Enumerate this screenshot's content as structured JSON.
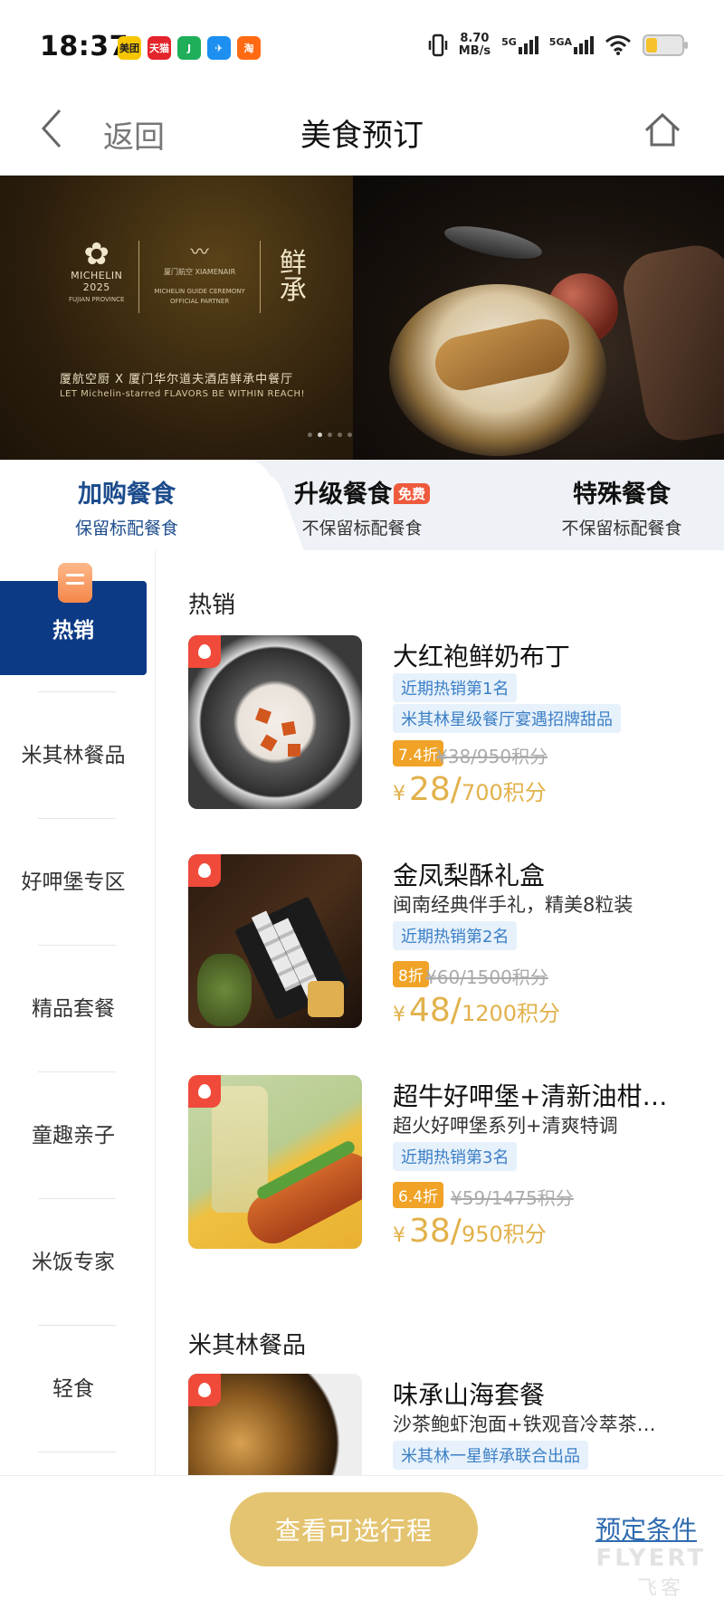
{
  "status_bar": {
    "time": "18:37",
    "apps": [
      {
        "label": "美团",
        "color": "#f7c600",
        "text_color": "#222"
      },
      {
        "label": "天猫",
        "color": "#e3252b",
        "text_color": "#fff"
      },
      {
        "label": "J",
        "color": "#1fae5a",
        "text_color": "#fff"
      },
      {
        "label": "✈",
        "color": "#1d8ff0",
        "text_color": "#fff"
      },
      {
        "label": "淘",
        "color": "#ff6a13",
        "text_color": "#fff"
      }
    ],
    "speed_top": "8.70",
    "speed_bottom": "MB/s",
    "net1": "5G",
    "net2": "5GA",
    "battery_pct": 0.25
  },
  "nav": {
    "back_label": "返回",
    "title": "美食预订"
  },
  "banner": {
    "michelin_name": "MICHELIN",
    "michelin_year": "2025",
    "michelin_region": "FUJIAN PROVINCE",
    "airline": "厦门航空 XIAMENAIR",
    "ceremony": "MICHELIN GUIDE CEREMONY",
    "partner": "OFFICIAL PARTNER",
    "restaurant_mark": "鲜承",
    "caption": "厦航空厨 X 厦门华尔道夫酒店鲜承中餐厅",
    "tagline": "LET Michelin-starred FLAVORS BE WITHIN REACH!"
  },
  "tabs": [
    {
      "title": "加购餐食",
      "sub": "保留标配餐食",
      "active": true
    },
    {
      "title": "升级餐食",
      "badge": "免费",
      "sub": "不保留标配餐食",
      "active": false
    },
    {
      "title": "特殊餐食",
      "sub": "不保留标配餐食",
      "active": false
    }
  ],
  "sidebar": [
    "热销",
    "米其林餐品",
    "好呷堡专区",
    "精品套餐",
    "童趣亲子",
    "米饭专家",
    "轻食"
  ],
  "sections": {
    "hot": "热销",
    "michelin": "米其林餐品"
  },
  "items": [
    {
      "name": "大红袍鲜奶布丁",
      "tags": [
        "近期热销第1名",
        "米其林星级餐厅宴遇招牌甜品"
      ],
      "discount": "7.4折",
      "original": "¥38/950积分",
      "yen": "¥",
      "price": "28/",
      "points": "700积分"
    },
    {
      "name": "金凤梨酥礼盒",
      "desc": "闽南经典伴手礼，精美8粒装",
      "tags": [
        "近期热销第2名"
      ],
      "discount": "8折",
      "original": "¥60/1500积分",
      "yen": "¥",
      "price": "48/",
      "points": "1200积分"
    },
    {
      "name": "超牛好呷堡+清新油柑…",
      "desc": "超火好呷堡系列+清爽特调",
      "tags": [
        "近期热销第3名"
      ],
      "discount": "6.4折",
      "original": "¥59/1475积分",
      "yen": "¥",
      "price": "38/",
      "points": "950积分"
    },
    {
      "name": "味承山海套餐",
      "desc": "沙茶鲍虾泡面+铁观音冷萃茶…",
      "tags": [
        "米其林一星鲜承联合出品"
      ]
    }
  ],
  "bottom": {
    "cta": "查看可选行程",
    "conditions": "预定条件",
    "watermark": "FLYERT",
    "watermark_cn": "飞客"
  },
  "colors": {
    "primary": "#0c3a85",
    "gold": "#e4c470",
    "price": "#e2b14b",
    "tag_blue": "#3c7fc6",
    "discount": "#f0a327",
    "flame": "#f04a3a"
  }
}
